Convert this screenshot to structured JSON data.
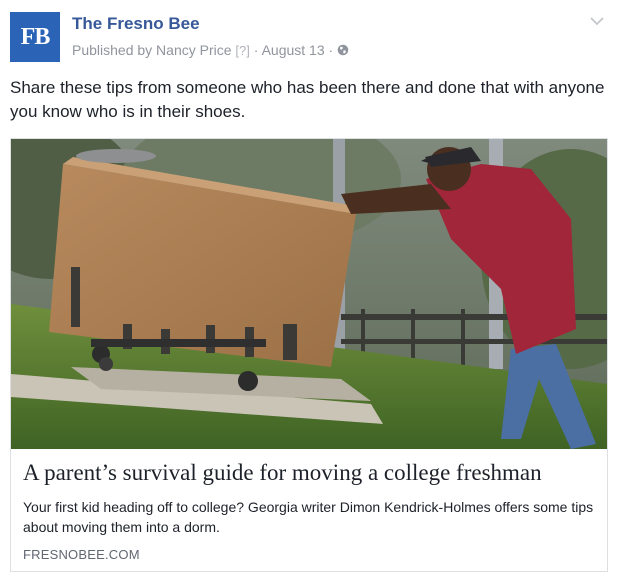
{
  "header": {
    "avatar_text": "FB",
    "page_name": "The Fresno Bee",
    "published_by": "Published by Nancy Price",
    "help_marker": "[?]",
    "separator": "·",
    "date": "August 13",
    "privacy_icon": "globe-icon",
    "menu_icon": "chevron-down-icon"
  },
  "post": {
    "message": "Share these tips from someone who has been there and done that with anyone you know who is in their shoes."
  },
  "link_card": {
    "image_alt": "Man pushing a large cardboard box on a cart up a grassy slope",
    "title": "A parent’s survival guide for moving a college freshman",
    "description": "Your first kid heading off to college? Georgia writer Dimon Kendrick-Holmes offers some tips about moving them into a dorm.",
    "domain": "FRESNOBEE.COM"
  },
  "colors": {
    "brand_blue": "#365899",
    "avatar_blue": "#2b63b7",
    "meta_gray": "#90949c"
  }
}
